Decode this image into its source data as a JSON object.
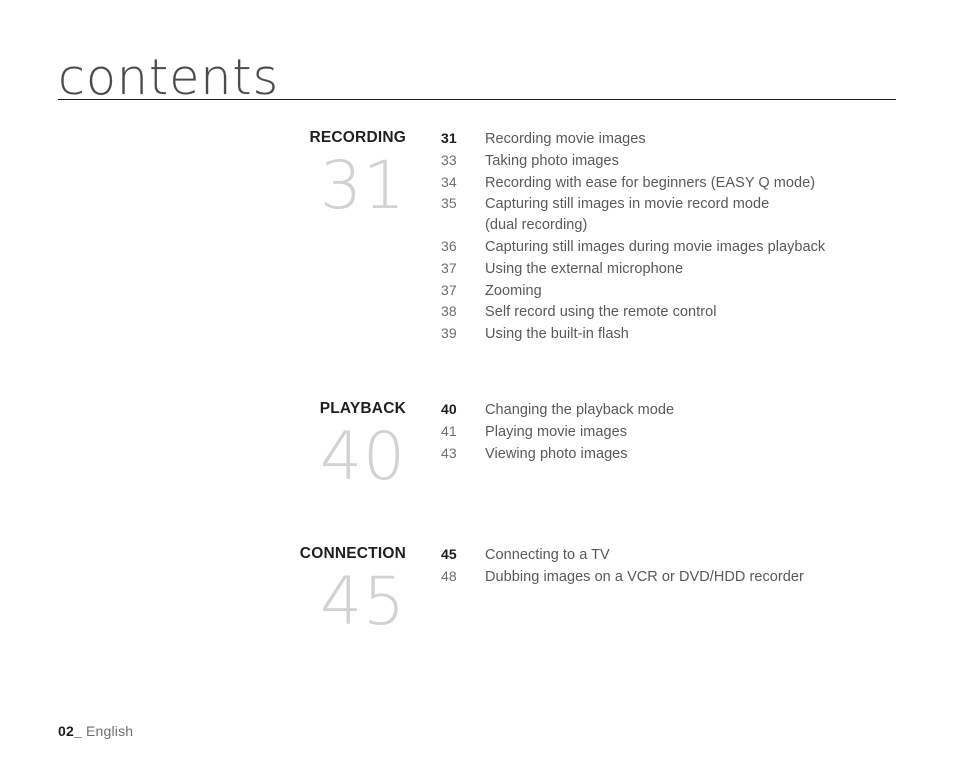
{
  "header": {
    "title": "contents"
  },
  "toc": {
    "sections": [
      {
        "title": "RECORDING",
        "big_number": "31",
        "entries": [
          {
            "page": "31",
            "label": "Recording movie images",
            "first": true
          },
          {
            "page": "33",
            "label": "Taking photo images"
          },
          {
            "page": "34",
            "label": "Recording with ease for beginners (EASY Q mode)"
          },
          {
            "page": "35",
            "label": "Capturing still images in movie record mode"
          },
          {
            "page": "",
            "label": "(dual recording)",
            "continuation": true
          },
          {
            "page": "36",
            "label": "Capturing still images during movie images playback"
          },
          {
            "page": "37",
            "label": "Using the external microphone"
          },
          {
            "page": "37",
            "label": "Zooming"
          },
          {
            "page": "38",
            "label": "Self record using the remote control"
          },
          {
            "page": "39",
            "label": "Using the built-in flash"
          }
        ]
      },
      {
        "title": "PLAYBACK",
        "big_number": "40",
        "entries": [
          {
            "page": "40",
            "label": "Changing the playback mode",
            "first": true
          },
          {
            "page": "41",
            "label": "Playing movie images"
          },
          {
            "page": "43",
            "label": "Viewing photo images"
          }
        ]
      },
      {
        "title": "CONNECTION",
        "big_number": "45",
        "entries": [
          {
            "page": "45",
            "label": "Connecting to a TV",
            "first": true
          },
          {
            "page": "48",
            "label": "Dubbing images on a VCR or DVD/HDD recorder"
          }
        ]
      }
    ]
  },
  "footer": {
    "page_number": "02_",
    "language": "English"
  },
  "colors": {
    "rule": "#1c1c1c",
    "section_title": "#231f20",
    "big_number": "#d2d2d2",
    "body_text": "#58595b",
    "page_number": "#6d6e70"
  }
}
